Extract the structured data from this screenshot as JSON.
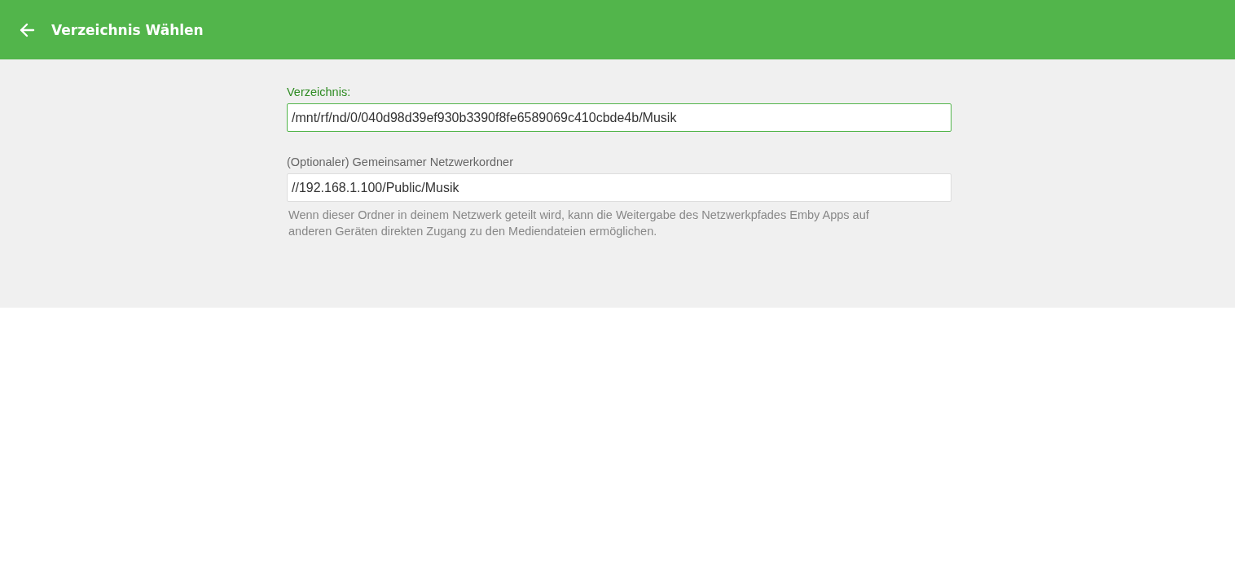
{
  "header": {
    "title": "Verzeichnis Wählen"
  },
  "fields": [
    {
      "label": "Verzeichnis:",
      "value": "/mnt/rf/nd/0/040d98d39ef930b3390f8fe6589069c410cbde4b/Musik",
      "focused": true
    },
    {
      "label": "(Optionaler) Gemeinsamer Netzwerkordner",
      "value": "//192.168.1.100/Public/Musik",
      "focused": false,
      "help": "Wenn dieser Ordner in deinem Netzwerk geteilt wird, kann die Weitergabe des Netzwerkpfades Emby Apps auf anderen Geräten direkten Zugang zu den Mediendateien ermöglichen."
    }
  ]
}
